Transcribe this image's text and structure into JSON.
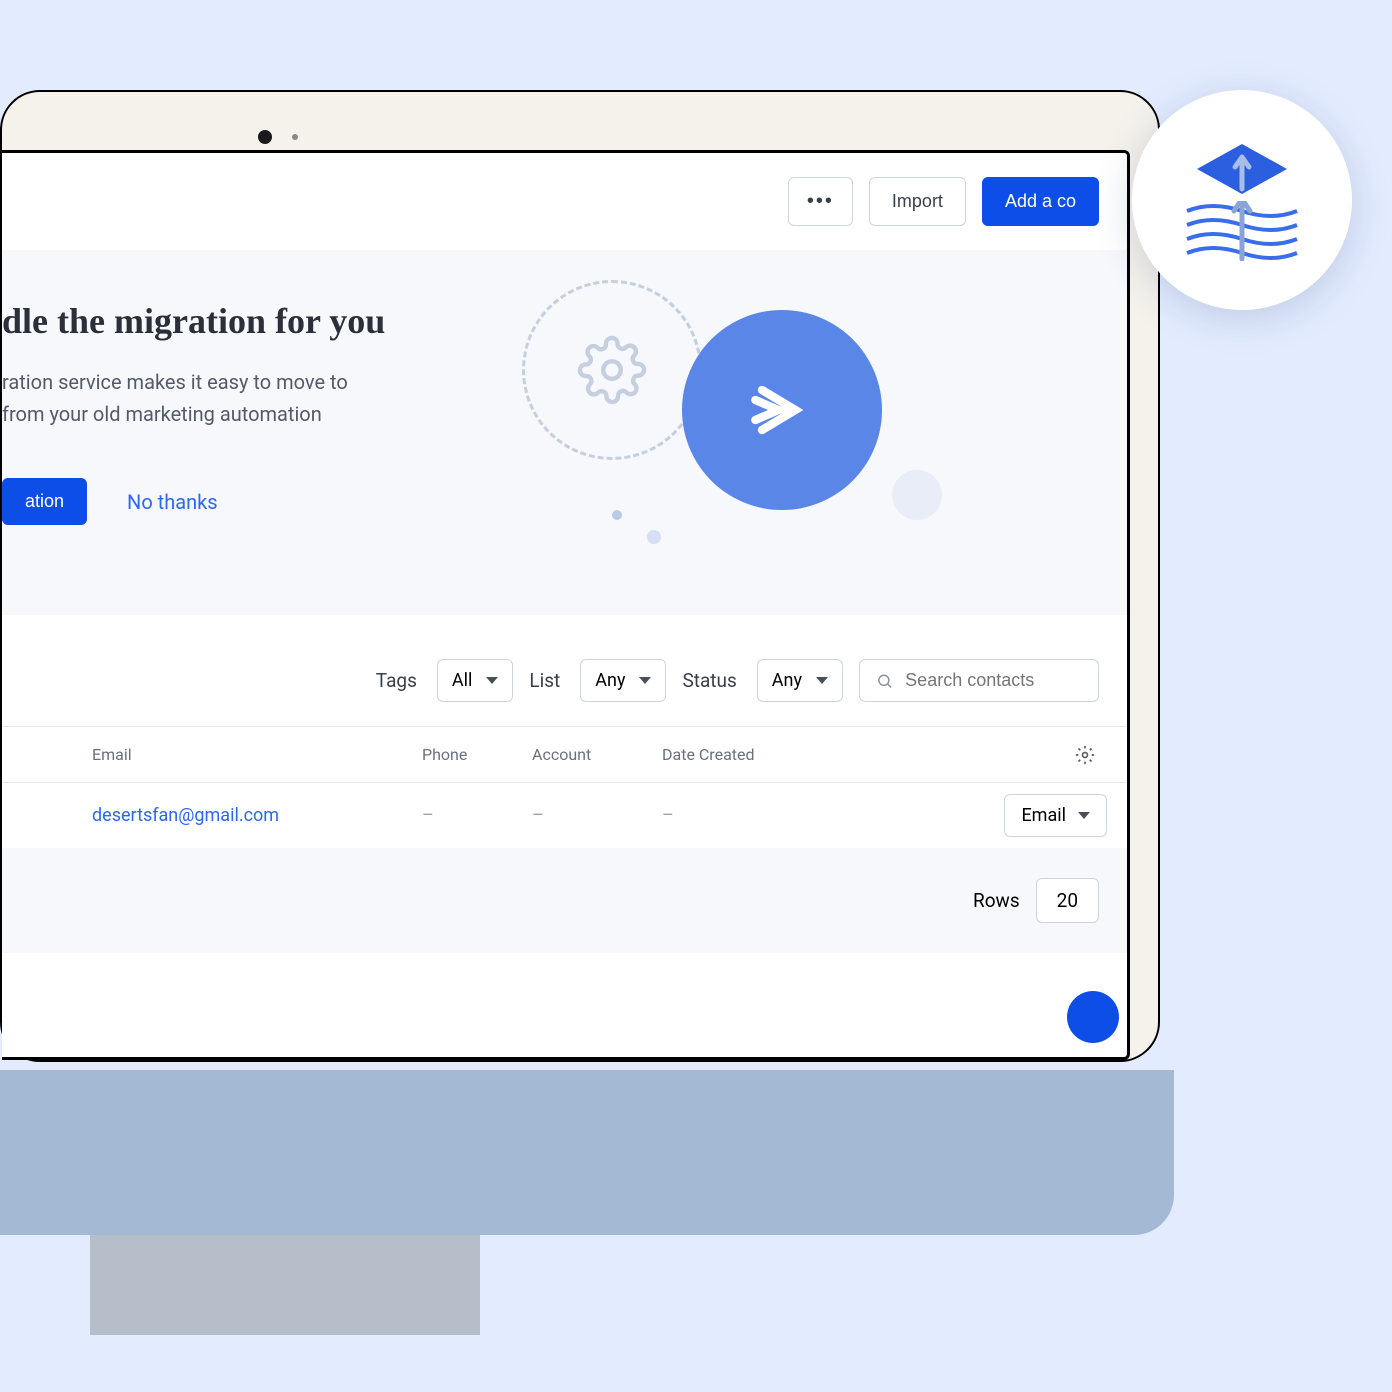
{
  "toolbar": {
    "more_label": "•••",
    "import_label": "Import",
    "add_label": "Add a co"
  },
  "hero": {
    "title": "dle the migration for you",
    "desc_line1": "ration service makes it easy to move to",
    "desc_line2": "from your old marketing automation",
    "primary_cta": "ation",
    "secondary_cta": "No thanks"
  },
  "filters": {
    "tags_label": "Tags",
    "tags_value": "All",
    "list_label": "List",
    "list_value": "Any",
    "status_label": "Status",
    "status_value": "Any",
    "search_placeholder": "Search contacts"
  },
  "table": {
    "headers": {
      "email": "Email",
      "phone": "Phone",
      "account": "Account",
      "date": "Date Created"
    },
    "rows": [
      {
        "email": "desertsfan@gmail.com",
        "phone": "–",
        "account": "–",
        "date": "–",
        "action": "Email"
      }
    ]
  },
  "footer": {
    "rows_label": "Rows",
    "rows_value": "20"
  }
}
